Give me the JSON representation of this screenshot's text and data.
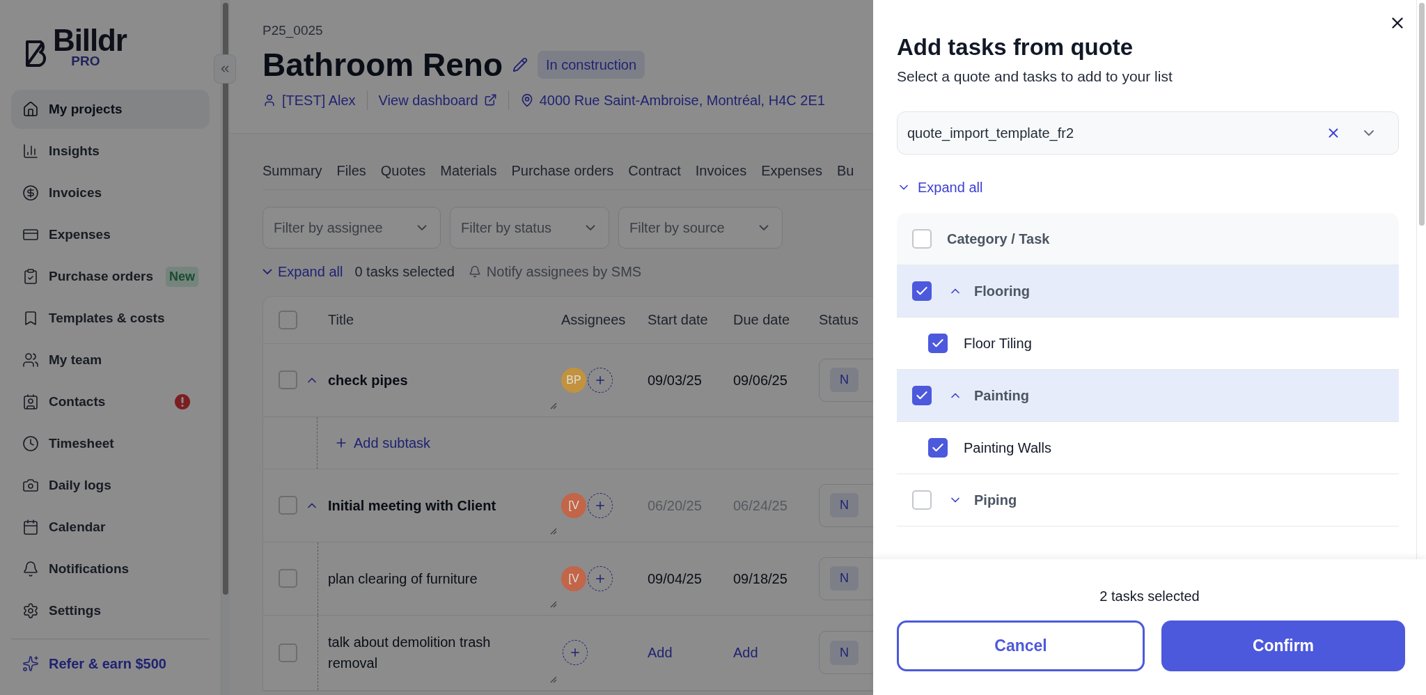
{
  "sidebar": {
    "logo": {
      "name": "Billdr",
      "tier": "PRO"
    },
    "items": [
      {
        "label": "My projects",
        "selected": true
      },
      {
        "label": "Insights",
        "selected": false
      },
      {
        "label": "Invoices",
        "selected": false
      },
      {
        "label": "Expenses",
        "selected": false
      },
      {
        "label": "Purchase orders",
        "selected": false,
        "badge": "New"
      },
      {
        "label": "Templates & costs",
        "selected": false
      },
      {
        "label": "My team",
        "selected": false
      },
      {
        "label": "Contacts",
        "selected": false,
        "alert": true
      },
      {
        "label": "Timesheet",
        "selected": false
      },
      {
        "label": "Daily logs",
        "selected": false
      },
      {
        "label": "Calendar",
        "selected": false
      },
      {
        "label": "Notifications",
        "selected": false
      },
      {
        "label": "Settings",
        "selected": false
      }
    ],
    "referral": "Refer & earn $500"
  },
  "project": {
    "code": "P25_0025",
    "title": "Bathroom Reno",
    "status": "In construction",
    "owner": "[TEST] Alex",
    "dashboard_link": "View dashboard",
    "address": "4000 Rue Saint-Ambroise, Montréal, H4C 2E1"
  },
  "tabs": [
    "Summary",
    "Files",
    "Quotes",
    "Materials",
    "Purchase orders",
    "Contract",
    "Invoices",
    "Expenses",
    "Bu"
  ],
  "filters": [
    {
      "placeholder": "Filter by assignee"
    },
    {
      "placeholder": "Filter by status"
    },
    {
      "placeholder": "Filter by source"
    }
  ],
  "toolbar": {
    "expand_all": "Expand all",
    "selection": "0 tasks selected",
    "notify": "Notify assignees by SMS"
  },
  "table": {
    "columns": [
      "Title",
      "Assignees",
      "Start date",
      "Due date",
      "Status"
    ],
    "header_checked": false,
    "rows": [
      {
        "kind": "task",
        "title": "check pipes",
        "checked": false,
        "expanded": true,
        "avatar": {
          "initials": "BP",
          "color": "#c2923e"
        },
        "start": "09/03/25",
        "due": "09/06/25",
        "dates_muted": false,
        "dates_set": true,
        "status": "N"
      },
      {
        "kind": "add",
        "title": "Add subtask"
      },
      {
        "kind": "task",
        "title": "Initial meeting with Client",
        "checked": false,
        "expanded": true,
        "avatar": {
          "initials": "[V",
          "color": "#c26548"
        },
        "start": "06/20/25",
        "due": "06/24/25",
        "dates_muted": true,
        "dates_set": true,
        "status": "N"
      },
      {
        "kind": "subtask",
        "title": "plan clearing of furniture",
        "checked": false,
        "avatar": {
          "initials": "[V",
          "color": "#c26548"
        },
        "start": "09/04/25",
        "due": "09/18/25",
        "dates_muted": false,
        "dates_set": true,
        "status": "N"
      },
      {
        "kind": "subtask",
        "title": "talk about demolition trash removal",
        "checked": false,
        "start": "Add",
        "due": "Add",
        "dates_set": false,
        "status": "N"
      }
    ]
  },
  "drawer": {
    "title": "Add tasks from quote",
    "subtitle": "Select a quote and tasks to add to your list",
    "quote_select": {
      "value": "quote_import_template_fr2"
    },
    "expand_all": "Expand all",
    "header": {
      "label": "Category / Task",
      "checked": false
    },
    "categories": [
      {
        "name": "Flooring",
        "checked": true,
        "expanded": true,
        "children": [
          {
            "name": "Floor Tiling",
            "checked": true
          }
        ]
      },
      {
        "name": "Painting",
        "checked": true,
        "expanded": true,
        "children": [
          {
            "name": "Painting Walls",
            "checked": true
          }
        ]
      },
      {
        "name": "Piping",
        "checked": false,
        "expanded": false
      }
    ],
    "selection": "2 tasks selected",
    "cancel": "Cancel",
    "confirm": "Confirm"
  }
}
